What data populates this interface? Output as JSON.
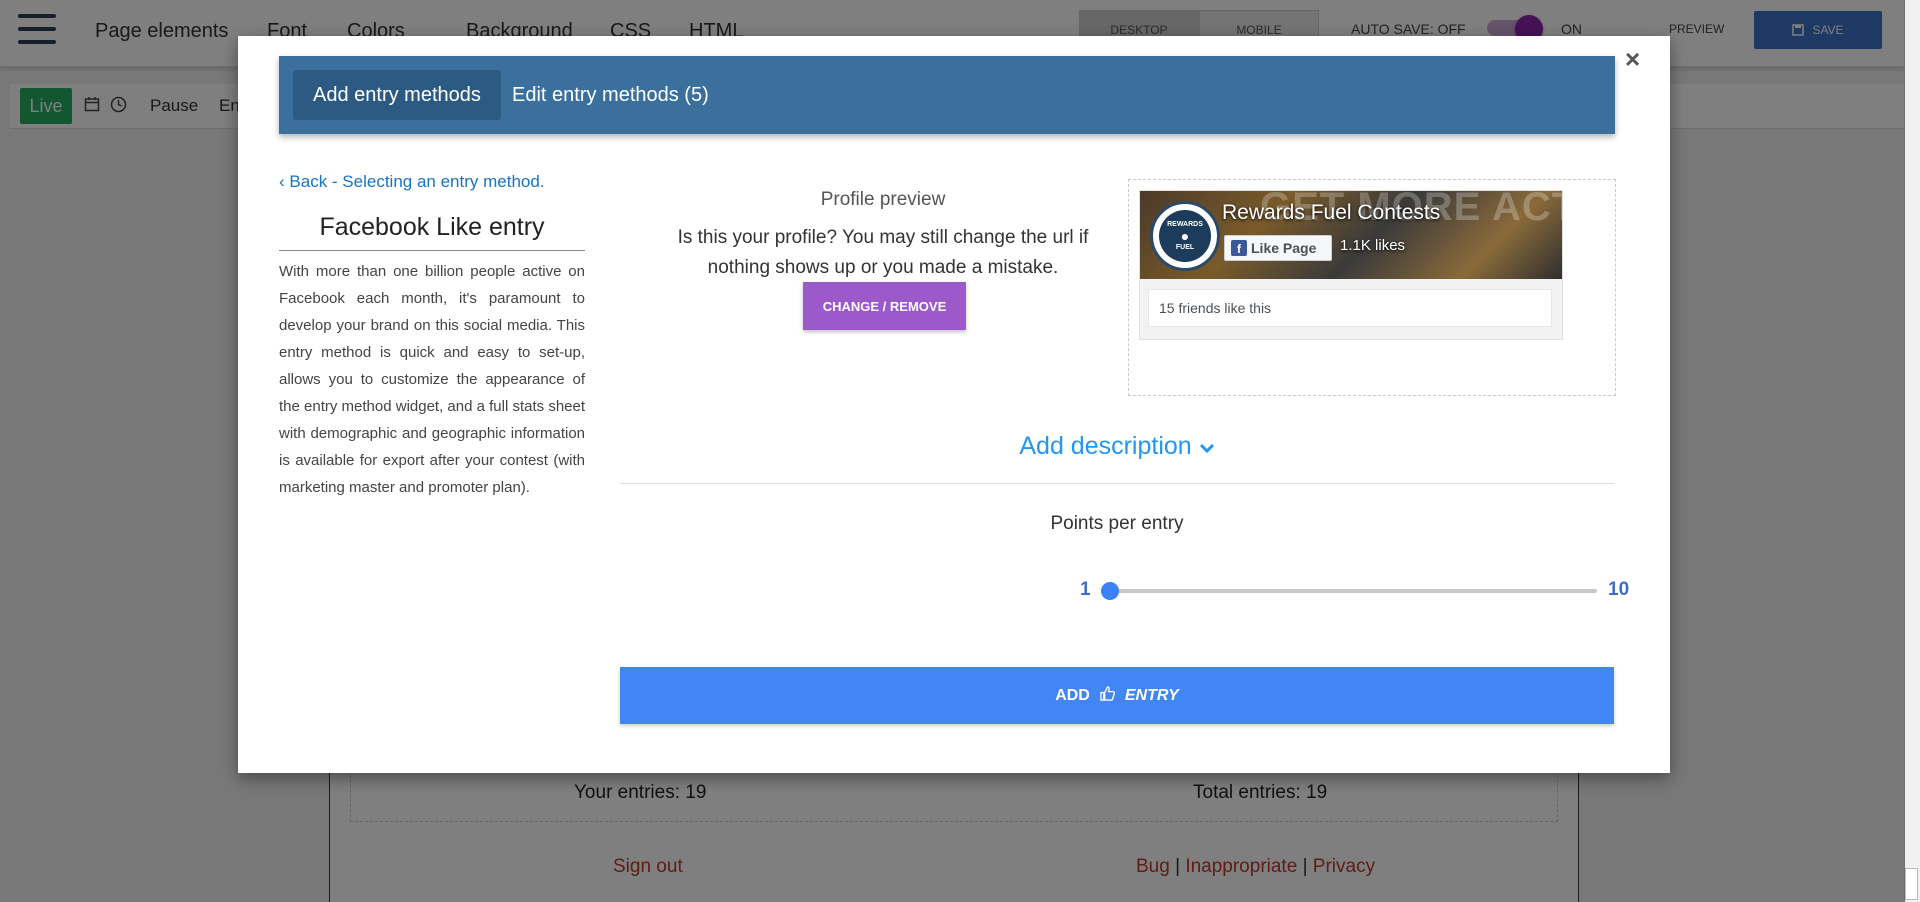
{
  "topbar": {
    "nav": [
      "Page elements",
      "Font",
      "Colors",
      "Background",
      "CSS",
      "HTML"
    ],
    "device_tabs": [
      "DESKTOP",
      "MOBILE"
    ],
    "autosave_label": "AUTO SAVE: OFF",
    "toggle_label": "ON",
    "preview_label": "PREVIEW",
    "save_label": "SAVE"
  },
  "toolbar": {
    "live_label": "Live",
    "pause_label": "Pause",
    "end_label": "En"
  },
  "page": {
    "your_entries": "Your entries: 19",
    "total_entries": "Total entries: 19",
    "sign_out": "Sign out",
    "bug": "Bug",
    "separator": "|",
    "inappropriate": "Inappropriate",
    "privacy": "Privacy"
  },
  "modal": {
    "close": "×",
    "tabs": [
      "Add entry methods",
      "Edit entry methods (5)"
    ],
    "back_link": "Back - Selecting an entry method.",
    "entry_title": "Facebook Like entry",
    "entry_description": "With more than one billion people active on Facebook each month, it's paramount to develop your brand on this social media. This entry method is quick and easy to set-up, allows you to customize the appearance of the entry method widget, and a full stats sheet with demographic and geographic information is available for export after your contest (with marketing master and promoter plan).",
    "profile_preview_label": "Profile preview",
    "profile_question": "Is this your profile? You may still change the url if nothing shows up or you made a mistake.",
    "change_remove_label": "CHANGE / REMOVE",
    "fb": {
      "cover_text": "GET MORE ACTION FACEBOOK",
      "logo_top": "REWARDS",
      "logo_bottom": "FUEL",
      "page_name": "Rewards Fuel Contests",
      "like_button": "Like Page",
      "likes": "1.1K likes",
      "friends": "15 friends like this"
    },
    "add_description": "Add description",
    "points_label": "Points per entry",
    "slider": {
      "min": "1",
      "max": "10",
      "value": 1,
      "min_value": 1,
      "max_value": 10
    },
    "add_entry": {
      "add": "ADD",
      "entry": "ENTRY"
    }
  },
  "colors": {
    "tabbar": "#3b6f9c",
    "accent_blue": "#4285f4",
    "change_button": "#9b59c9",
    "live_green": "#27ae60",
    "link_red": "#c0392b"
  },
  "icons": [
    "hamburger-icon",
    "calendar-icon",
    "clock-icon",
    "save-icon",
    "chevron-left-icon",
    "chevron-down-icon",
    "thumbs-up-icon",
    "close-icon",
    "facebook-icon"
  ]
}
